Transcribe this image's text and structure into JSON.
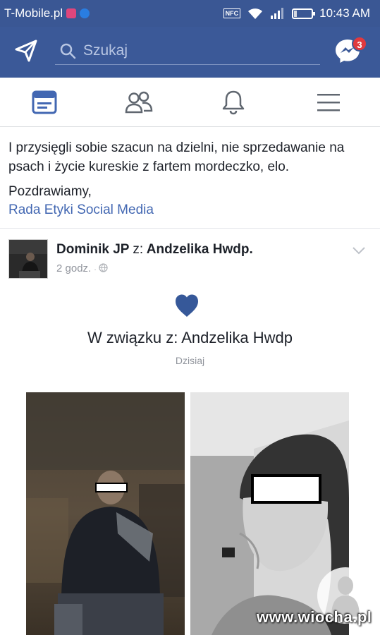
{
  "status_bar": {
    "carrier": "T-Mobile.pl",
    "nfc_label": "NFC",
    "battery_level": "8",
    "time": "10:43 AM"
  },
  "header": {
    "search_placeholder": "Szukaj",
    "messenger_badge": "3"
  },
  "tabs": [
    {
      "icon": "news-feed-icon",
      "active": true
    },
    {
      "icon": "friends-icon",
      "active": false
    },
    {
      "icon": "bell-icon",
      "active": false
    },
    {
      "icon": "menu-icon",
      "active": false
    }
  ],
  "notice": {
    "text": "I przysięgli sobie szacun na dzielni, nie sprzedawanie na psach i życie kureskie z fartem mordeczko, elo.",
    "greeting": "Pozdrawiamy,",
    "signature": "Rada Etyki Social Media"
  },
  "post": {
    "author": "Dominik JP",
    "with_label": "z:",
    "tagged": "Andzelika Hwdp.",
    "time": "2 godz.",
    "relationship_text": "W związku z: Andzelika Hwdp",
    "relationship_date": "Dzisiaj"
  },
  "watermark": "www.wiocha.pl",
  "colors": {
    "facebook_blue": "#3b5998",
    "status_blue": "#3a5794",
    "link_blue": "#4267b2",
    "heart_blue": "#365899",
    "badge_red": "#e0393e",
    "muted_gray": "#90949c"
  }
}
